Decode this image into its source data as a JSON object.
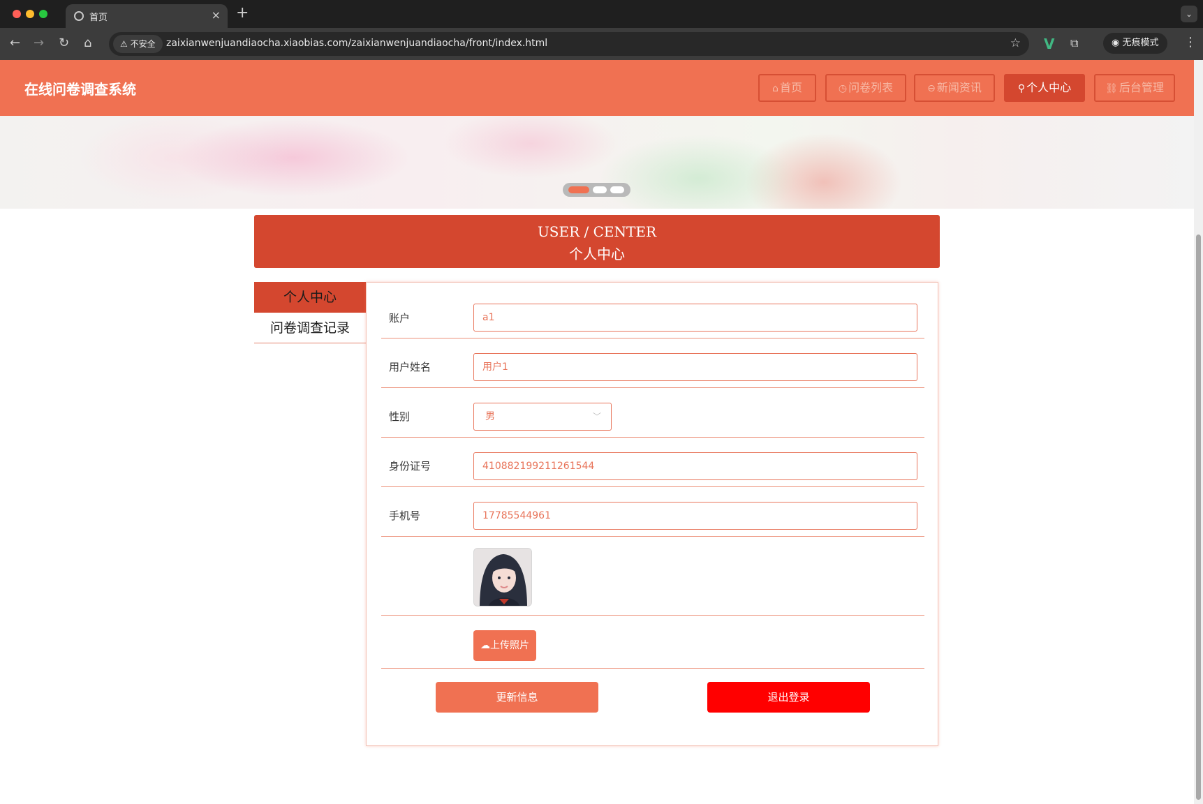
{
  "browser": {
    "tab_title": "首页",
    "security_label": "不安全",
    "url": "zaixianwenjuandiaocha.xiaobias.com/zaixianwenjuandiaocha/front/index.html",
    "incognito_label": "无痕模式"
  },
  "header": {
    "site_title": "在线问卷调查系统",
    "nav": [
      {
        "label": "首页",
        "icon": "home-icon"
      },
      {
        "label": "问卷列表",
        "icon": "clock-icon"
      },
      {
        "label": "新闻资讯",
        "icon": "minus-circle-icon"
      },
      {
        "label": "个人中心",
        "icon": "user-icon",
        "active": true
      },
      {
        "label": "后台管理",
        "icon": "link-icon"
      }
    ]
  },
  "user_center": {
    "title_en": "USER / CENTER",
    "title_cn": "个人中心"
  },
  "sidebar": {
    "items": [
      {
        "label": "个人中心",
        "active": true
      },
      {
        "label": "问卷调查记录",
        "active": false
      }
    ]
  },
  "form": {
    "account_label": "账户",
    "account_value": "a1",
    "name_label": "用户姓名",
    "name_value": "用户1",
    "gender_label": "性别",
    "gender_value": "男",
    "id_label": "身份证号",
    "id_value": "410882199211261544",
    "phone_label": "手机号",
    "phone_value": "17785544961",
    "upload_label": "上传照片",
    "update_label": "更新信息",
    "logout_label": "退出登录"
  },
  "colors": {
    "primary": "#f07152",
    "primary_dark": "#d4472f",
    "danger": "#ff0000"
  }
}
